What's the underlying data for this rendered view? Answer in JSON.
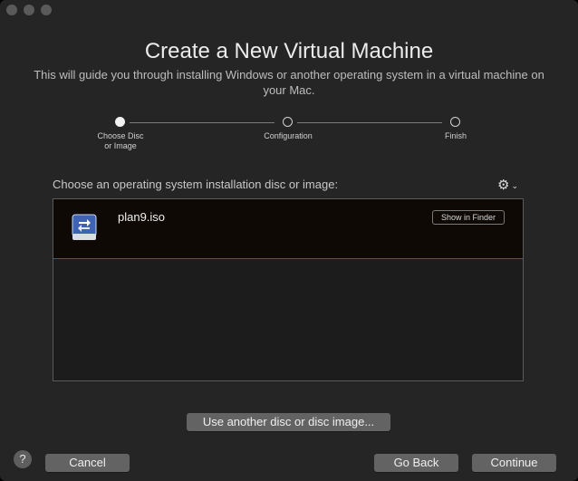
{
  "header": {
    "title": "Create a New Virtual Machine",
    "subtitle": "This will guide you through installing Windows or another operating system in a virtual machine on your Mac."
  },
  "steps": [
    {
      "label": "Choose Disc\nor Image",
      "active": true
    },
    {
      "label": "Configuration",
      "active": false
    },
    {
      "label": "Finish",
      "active": false
    }
  ],
  "chooser": {
    "label": "Choose an operating system installation disc or image:",
    "items": [
      {
        "name": "plan9.iso",
        "action": "Show in Finder",
        "icon": "disc-image-icon"
      }
    ]
  },
  "buttons": {
    "use_another": "Use another disc or disc image...",
    "help": "?",
    "cancel": "Cancel",
    "go_back": "Go Back",
    "continue": "Continue"
  },
  "colors": {
    "window_bg": "#252525",
    "selection_bg": "#0e0905",
    "icon_blue": "#3e63b3"
  }
}
